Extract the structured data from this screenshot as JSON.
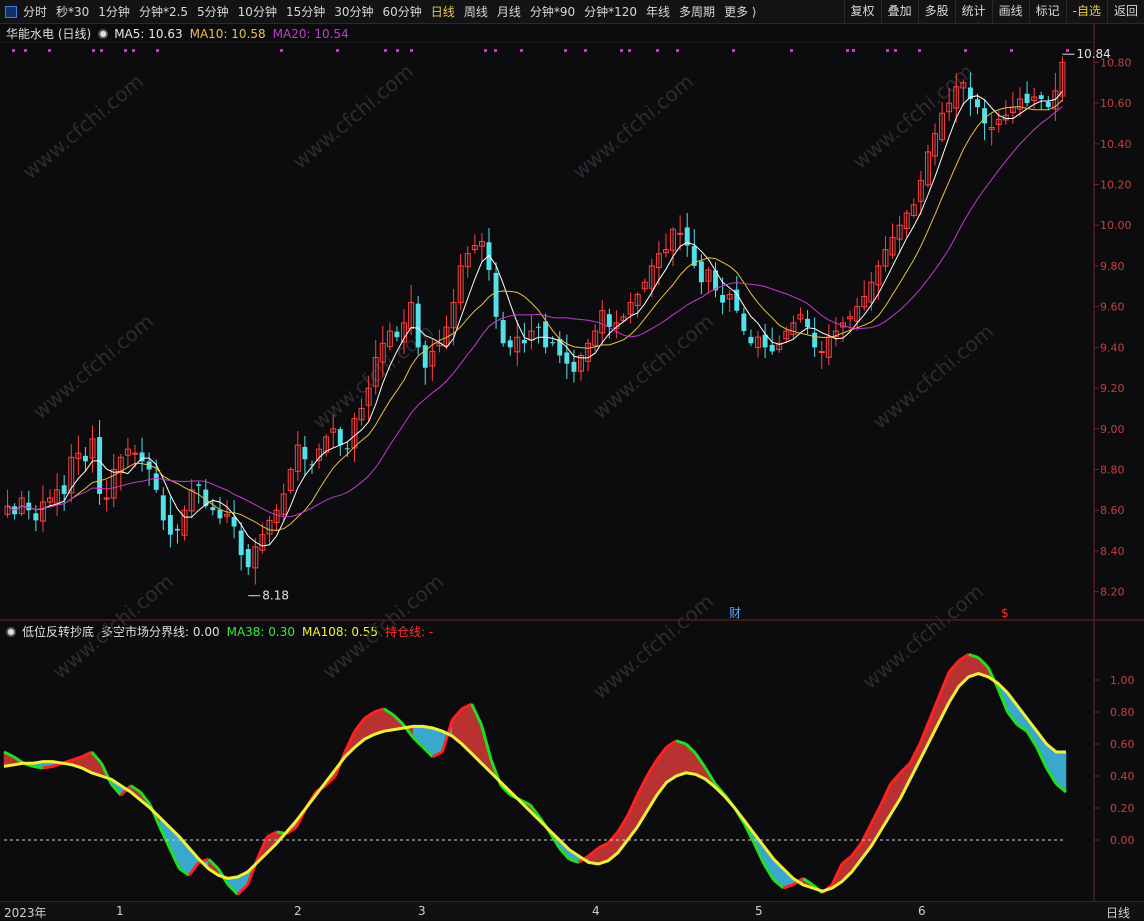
{
  "toolbar": {
    "timeframes": [
      "分时",
      "秒*30",
      "1分钟",
      "分钟*2.5",
      "5分钟",
      "10分钟",
      "15分钟",
      "30分钟",
      "60分钟",
      "日线",
      "周线",
      "月线",
      "分钟*90",
      "分钟*120",
      "年线",
      "多周期",
      "更多 ⟩"
    ],
    "active": "日线",
    "right_buttons": [
      "复权",
      "叠加",
      "多股",
      "统计",
      "画线",
      "标记",
      "-自选",
      "返回"
    ]
  },
  "main": {
    "title": "华能水电 (日线)",
    "ma5_label": "MA5: 10.63",
    "ma10_label": "MA10: 10.58",
    "ma20_label": "MA20: 10.54",
    "high_marker": "10.84",
    "low_marker": "8.18",
    "event_cai": "财",
    "event_dollar": "$",
    "watermark": "www.cfchi.com"
  },
  "sub": {
    "title": "低位反转抄底",
    "boundary": "多空市场分界线: 0.00",
    "ma38": "MA38: 0.30",
    "ma108": "MA108: 0.55",
    "hold": "持仓线: -"
  },
  "bottom": {
    "year": "2023年",
    "months": [
      "1",
      "2",
      "3",
      "4",
      "5",
      "6"
    ],
    "period": "日线"
  },
  "colors": {
    "up": "#ff4040",
    "down": "#54e0e8",
    "ma5": "#ffffff",
    "ma10": "#e6c04a",
    "ma20": "#c03cc8",
    "axis": "#c04040"
  },
  "chart_data": [
    {
      "type": "candlestick",
      "title": "华能水电 (日线)",
      "ylim": [
        8.1,
        10.9
      ],
      "yticks": [
        8.2,
        8.4,
        8.6,
        8.8,
        9.0,
        9.2,
        9.4,
        9.6,
        9.8,
        10.0,
        10.2,
        10.4,
        10.6,
        10.8
      ],
      "closes": [
        8.62,
        8.58,
        8.66,
        8.6,
        8.55,
        8.64,
        8.66,
        8.7,
        8.68,
        8.86,
        8.88,
        8.84,
        8.95,
        8.68,
        8.66,
        8.8,
        8.86,
        8.9,
        8.88,
        8.84,
        8.8,
        8.7,
        8.55,
        8.48,
        8.5,
        8.6,
        8.7,
        8.72,
        8.62,
        8.6,
        8.56,
        8.58,
        8.52,
        8.38,
        8.32,
        8.42,
        8.48,
        8.55,
        8.6,
        8.68,
        8.8,
        8.92,
        8.85,
        8.82,
        8.9,
        8.96,
        9.0,
        8.92,
        8.9,
        9.05,
        9.1,
        9.2,
        9.35,
        9.42,
        9.48,
        9.45,
        9.52,
        9.62,
        9.4,
        9.3,
        9.38,
        9.42,
        9.5,
        9.62,
        9.8,
        9.86,
        9.9,
        9.92,
        9.78,
        9.55,
        9.42,
        9.4,
        9.45,
        9.42,
        9.48,
        9.5,
        9.4,
        9.42,
        9.36,
        9.32,
        9.28,
        9.36,
        9.42,
        9.48,
        9.58,
        9.5,
        9.52,
        9.55,
        9.62,
        9.66,
        9.72,
        9.8,
        9.86,
        9.88,
        9.98,
        9.96,
        9.9,
        9.8,
        9.72,
        9.78,
        9.68,
        9.62,
        9.66,
        9.58,
        9.48,
        9.42,
        9.45,
        9.4,
        9.38,
        9.42,
        9.48,
        9.52,
        9.56,
        9.5,
        9.4,
        9.38,
        9.45,
        9.48,
        9.52,
        9.55,
        9.6,
        9.65,
        9.72,
        9.8,
        9.88,
        9.94,
        10.0,
        10.06,
        10.1,
        10.22,
        10.36,
        10.45,
        10.55,
        10.6,
        10.68,
        10.7,
        10.62,
        10.58,
        10.5,
        10.48,
        10.52,
        10.54,
        10.58,
        10.62,
        10.6,
        10.63,
        10.62,
        10.58,
        10.66,
        10.8
      ],
      "ma_labels": [
        "MA5: 10.63",
        "MA10: 10.58",
        "MA20: 10.54"
      ],
      "high": 10.84,
      "low": 8.18
    },
    {
      "type": "area",
      "title": "低位反转抄底",
      "ylim": [
        -0.35,
        1.25
      ],
      "yticks": [
        0.0,
        0.2,
        0.4,
        0.6,
        0.8,
        1.0
      ],
      "fast": [
        0.55,
        0.52,
        0.48,
        0.46,
        0.45,
        0.46,
        0.48,
        0.5,
        0.52,
        0.55,
        0.48,
        0.35,
        0.28,
        0.34,
        0.3,
        0.22,
        0.08,
        -0.05,
        -0.18,
        -0.22,
        -0.14,
        -0.12,
        -0.18,
        -0.28,
        -0.34,
        -0.28,
        -0.12,
        0.02,
        0.05,
        0.04,
        0.08,
        0.2,
        0.3,
        0.34,
        0.4,
        0.55,
        0.68,
        0.76,
        0.8,
        0.82,
        0.78,
        0.72,
        0.64,
        0.58,
        0.52,
        0.55,
        0.75,
        0.82,
        0.85,
        0.72,
        0.5,
        0.34,
        0.28,
        0.25,
        0.22,
        0.14,
        0.05,
        -0.05,
        -0.12,
        -0.14,
        -0.1,
        -0.05,
        -0.02,
        0.05,
        0.15,
        0.28,
        0.4,
        0.5,
        0.58,
        0.62,
        0.6,
        0.54,
        0.45,
        0.35,
        0.28,
        0.2,
        0.1,
        -0.02,
        -0.15,
        -0.25,
        -0.3,
        -0.28,
        -0.24,
        -0.28,
        -0.33,
        -0.28,
        -0.15,
        -0.1,
        -0.02,
        0.1,
        0.22,
        0.35,
        0.42,
        0.48,
        0.6,
        0.75,
        0.9,
        1.05,
        1.12,
        1.16,
        1.14,
        1.08,
        0.95,
        0.8,
        0.72,
        0.68,
        0.58,
        0.45,
        0.35,
        0.3
      ],
      "slow": [
        0.46,
        0.47,
        0.48,
        0.48,
        0.49,
        0.49,
        0.48,
        0.47,
        0.45,
        0.42,
        0.4,
        0.38,
        0.34,
        0.3,
        0.25,
        0.2,
        0.14,
        0.08,
        0.02,
        -0.05,
        -0.12,
        -0.18,
        -0.22,
        -0.24,
        -0.23,
        -0.2,
        -0.14,
        -0.08,
        -0.02,
        0.05,
        0.12,
        0.2,
        0.28,
        0.36,
        0.44,
        0.52,
        0.58,
        0.63,
        0.66,
        0.68,
        0.69,
        0.7,
        0.71,
        0.71,
        0.7,
        0.68,
        0.65,
        0.6,
        0.54,
        0.48,
        0.42,
        0.36,
        0.3,
        0.24,
        0.18,
        0.12,
        0.06,
        0.0,
        -0.06,
        -0.1,
        -0.14,
        -0.15,
        -0.13,
        -0.08,
        0.0,
        0.08,
        0.18,
        0.28,
        0.36,
        0.4,
        0.42,
        0.41,
        0.38,
        0.33,
        0.27,
        0.2,
        0.12,
        0.04,
        -0.04,
        -0.12,
        -0.18,
        -0.24,
        -0.28,
        -0.3,
        -0.32,
        -0.3,
        -0.26,
        -0.2,
        -0.12,
        -0.04,
        0.06,
        0.16,
        0.26,
        0.38,
        0.5,
        0.62,
        0.74,
        0.86,
        0.96,
        1.02,
        1.04,
        1.02,
        0.98,
        0.92,
        0.84,
        0.76,
        0.68,
        0.6,
        0.55,
        0.55
      ],
      "zero_line": 0.0
    }
  ]
}
